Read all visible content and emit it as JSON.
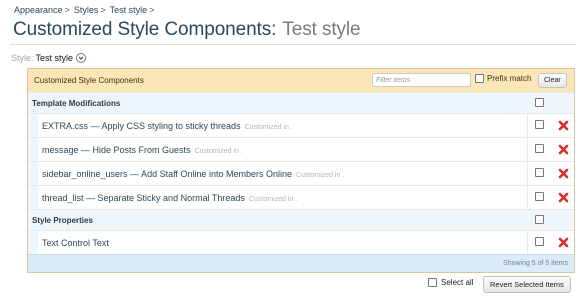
{
  "breadcrumb": [
    "Appearance",
    "Styles",
    "Test style"
  ],
  "title": {
    "main": "Customized Style Components:",
    "suffix": "Test style"
  },
  "style_selector": {
    "label": "Style:",
    "value": "Test style",
    "icon": "chevron-down-icon"
  },
  "panel": {
    "heading": "Customized Style Components",
    "filter_placeholder": "Filter items",
    "prefix_match_label": "Prefix match",
    "clear_label": "Clear"
  },
  "sections": [
    {
      "label": "Template Modifications",
      "items": [
        {
          "name": "EXTRA.css — Apply CSS styling to sticky threads",
          "note": "Customized in ."
        },
        {
          "name": "message — Hide Posts From Guests",
          "note": "Customized in ."
        },
        {
          "name": "sidebar_online_users — Add Staff Online into Members Online",
          "note": "Customized in ."
        },
        {
          "name": "thread_list — Separate Sticky and Normal Threads",
          "note": "Customized in ."
        }
      ]
    },
    {
      "label": "Style Properties",
      "items": [
        {
          "name": "Text Control Text",
          "note": ""
        }
      ]
    }
  ],
  "footer": {
    "showing": "Showing 5 of 5 items"
  },
  "actions": {
    "select_all": "Select all",
    "revert": "Revert Selected Items"
  },
  "colors": {
    "link": "#2b485c",
    "panel_head": "#fbe6b8",
    "section_bg": "#f0f7fc",
    "footer_bg": "#d9ecf8",
    "delete": "#d42b2b"
  }
}
